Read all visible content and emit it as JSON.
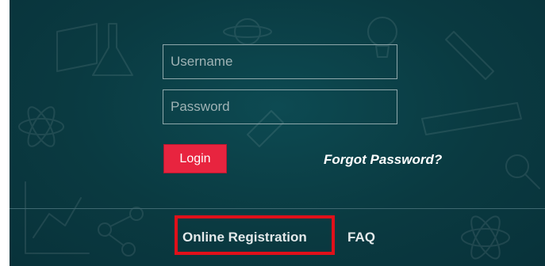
{
  "login_form": {
    "username_placeholder": "Username",
    "username_value": "",
    "password_placeholder": "Password",
    "password_value": "",
    "login_label": "Login",
    "forgot_password_label": "Forgot Password?"
  },
  "footer": {
    "links": [
      {
        "label": "Online Registration",
        "highlighted": true
      },
      {
        "label": "FAQ",
        "highlighted": false
      }
    ]
  },
  "colors": {
    "panel_background": "#0a3a41",
    "login_button": "#e8243f",
    "highlight_border": "#e0101a",
    "text": "#ffffff"
  },
  "icons": {
    "background_pattern": "science-doodles-pattern"
  }
}
